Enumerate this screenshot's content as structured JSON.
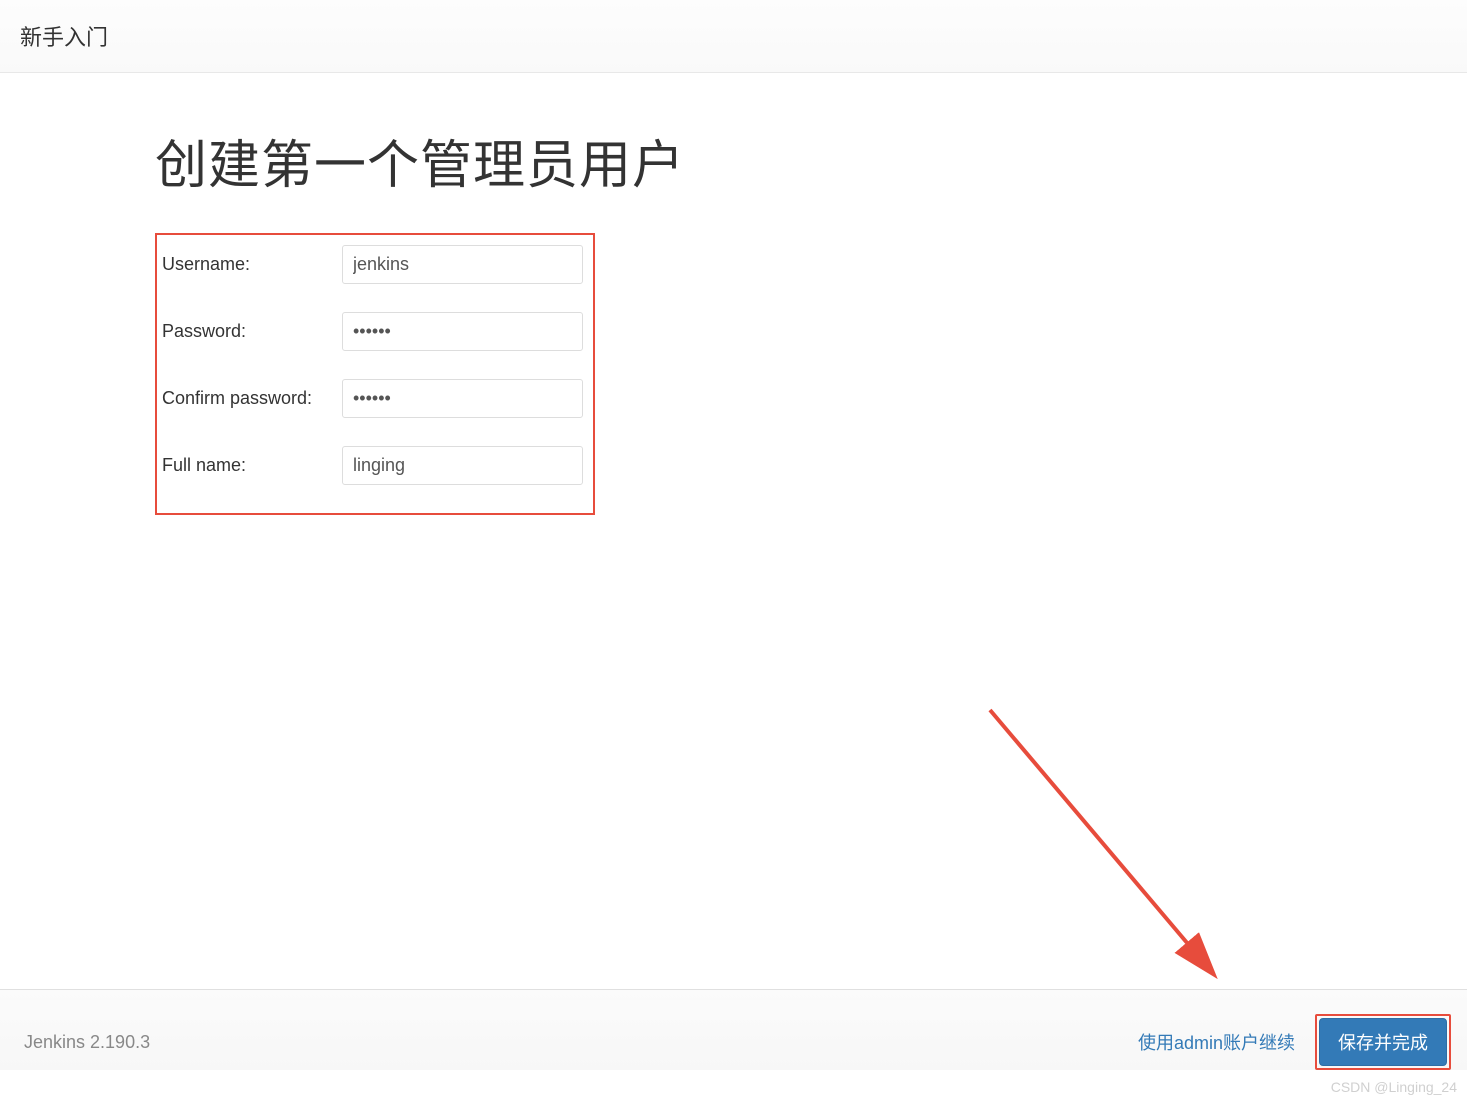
{
  "header": {
    "title": "新手入门"
  },
  "page": {
    "title": "创建第一个管理员用户"
  },
  "form": {
    "username": {
      "label": "Username:",
      "value": "jenkins"
    },
    "password": {
      "label": "Password:",
      "value": "••••••"
    },
    "confirm_password": {
      "label": "Confirm password:",
      "value": "••••••"
    },
    "fullname": {
      "label": "Full name:",
      "value": "linging"
    }
  },
  "footer": {
    "version": "Jenkins 2.190.3",
    "continue_link": "使用admin账户继续",
    "save_button": "保存并完成"
  },
  "watermark": "CSDN @Linging_24",
  "colors": {
    "highlight_border": "#e74c3c",
    "primary_button": "#337ab7",
    "link": "#337ab7"
  }
}
